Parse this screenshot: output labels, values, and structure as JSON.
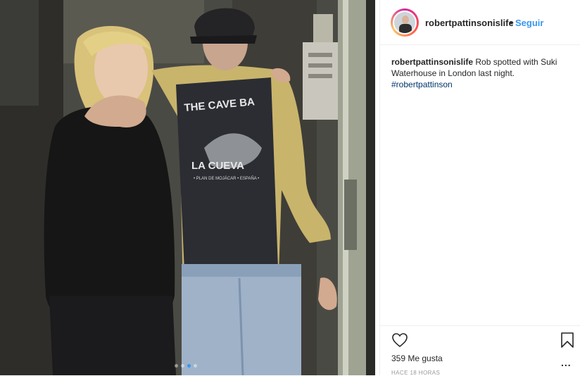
{
  "post": {
    "username": "robertpattinsonislife",
    "separator": "•",
    "follow_label": "Seguir",
    "caption_text": " Rob spotted with Suki Waterhouse in London last night.",
    "hashtag": "#robertpattinson",
    "print_text_1": "THE CAVE BA",
    "print_text_2": "LA CUEVA",
    "print_text_3": "• PLAN DE MOJÁCAR • ESPAÑA •",
    "likes": "359 Me gusta",
    "timestamp": "HACE 18 HORAS",
    "more_label": "...",
    "carousel": {
      "count": 4,
      "active_index": 2
    }
  },
  "icons": {
    "heart": "heart-outline-icon",
    "bookmark": "bookmark-outline-icon",
    "more": "more-options-icon"
  },
  "colors": {
    "link_blue": "#3897f0",
    "hashtag_blue": "#003569",
    "text": "#262626",
    "muted": "#999999",
    "border": "#efefef"
  }
}
